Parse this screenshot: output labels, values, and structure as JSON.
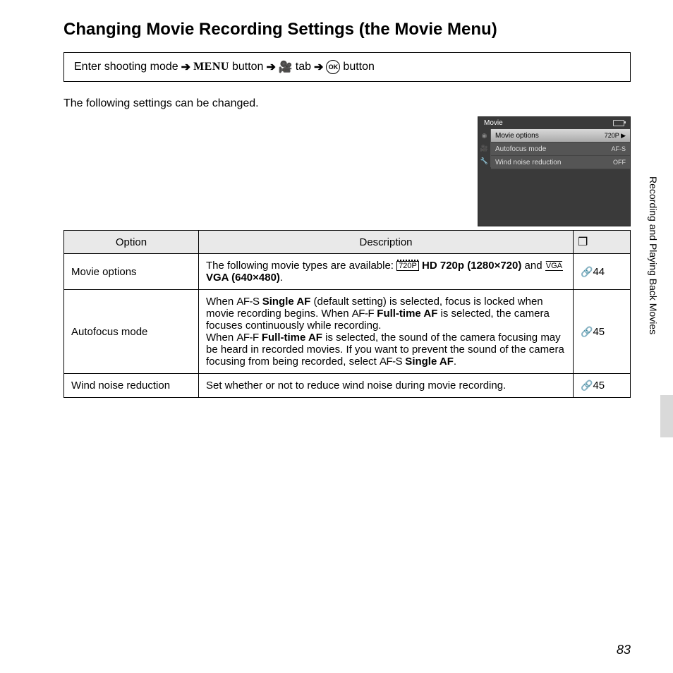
{
  "title": "Changing Movie Recording Settings (the Movie Menu)",
  "nav": {
    "step1": "Enter shooting mode",
    "menu_label": "MENU",
    "button_word": "button",
    "tab_word": "tab",
    "ok_label": "OK"
  },
  "intro": "The following settings can be changed.",
  "screenshot": {
    "title": "Movie",
    "rows": [
      {
        "label": "Movie options",
        "value": "720P",
        "selected": true
      },
      {
        "label": "Autofocus mode",
        "value": "AF-S",
        "selected": false
      },
      {
        "label": "Wind noise reduction",
        "value": "OFF",
        "selected": false
      }
    ]
  },
  "table": {
    "headers": {
      "option": "Option",
      "description": "Description"
    },
    "rows": [
      {
        "option": "Movie options",
        "desc_pre": "The following movie types are available: ",
        "hd_icon": "720P",
        "hd_label": "HD 720p (1280×720)",
        "and": " and ",
        "vga_icon": "VGA",
        "vga_label": "VGA (640×480)",
        "ref": "44"
      },
      {
        "option": "Autofocus mode",
        "p1a": "When ",
        "afs": "AF-S",
        "single_af": " Single AF",
        "p1b": " (default setting) is selected, focus is locked when movie recording begins. When ",
        "aff": "AF-F",
        "fulltime": " Full-time AF",
        "p1c": " is selected, the camera focuses continuously while recording.",
        "p2a": "When ",
        "p2b": " is selected, the sound of the camera focusing may be heard in recorded movies. If you want to prevent the sound of the camera focusing from being recorded, select ",
        "period": ".",
        "ref": "45"
      },
      {
        "option": "Wind noise reduction",
        "desc": "Set whether or not to reduce wind noise during movie recording.",
        "ref": "45"
      }
    ]
  },
  "side_label": "Recording and Playing Back Movies",
  "page_number": "83"
}
